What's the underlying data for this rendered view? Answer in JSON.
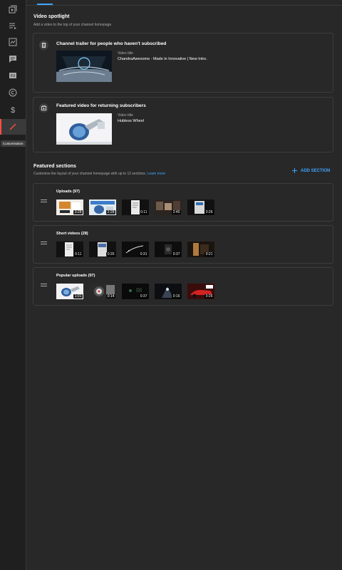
{
  "sidebar": {
    "items": [
      {
        "name": "content"
      },
      {
        "name": "playlists"
      },
      {
        "name": "analytics"
      },
      {
        "name": "comments"
      },
      {
        "name": "subtitles"
      },
      {
        "name": "copyright"
      },
      {
        "name": "monetization"
      },
      {
        "name": "customization"
      }
    ],
    "tooltip": "Customisation"
  },
  "spotlight": {
    "title": "Video spotlight",
    "subtitle": "Add a video to the top of your channel homepage",
    "trailer": {
      "heading": "Channel trailer for people who haven't subscribed",
      "label": "Video title",
      "value": "ChandraAwesome - Made in Innovative | New Intro."
    },
    "featured": {
      "heading": "Featured video for returning subscribers",
      "label": "Video title",
      "value": "Hubless Wheel"
    }
  },
  "featured_sections": {
    "title": "Featured sections",
    "subtitle": "Customise the layout of your channel homepage with up to 12 sections.",
    "learn_more": "Learn more",
    "add_label": "ADD SECTION",
    "sections": [
      {
        "title": "Uploads (97)",
        "durations": [
          "3:28",
          "2:28",
          "0:11",
          "2:45",
          "0:26"
        ]
      },
      {
        "title": "Short videos (28)",
        "durations": [
          "0:11",
          "0:26",
          "0:31",
          "0:37",
          "0:21"
        ]
      },
      {
        "title": "Popular uploads (97)",
        "durations": [
          "1:01",
          "0:14",
          "0:37",
          "0:16",
          "0:26"
        ]
      }
    ]
  },
  "colors": {
    "accent": "#3ea6ff",
    "active_marker": "#ff4e45"
  }
}
